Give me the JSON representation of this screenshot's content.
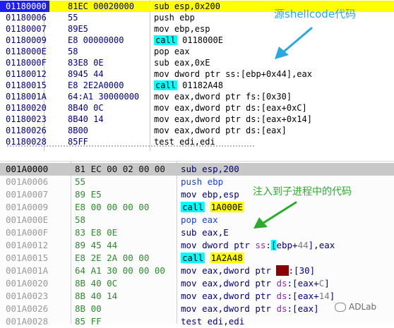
{
  "top_panel": {
    "annotation": "源shellcode代码",
    "rows": [
      {
        "addr": "01180000",
        "hex": "81EC 00020000",
        "pre": "sub esp,0x200",
        "call": "",
        "post": ""
      },
      {
        "addr": "01180006",
        "hex": "55",
        "pre": "push ebp",
        "call": "",
        "post": ""
      },
      {
        "addr": "01180007",
        "hex": "89E5",
        "pre": "mov ebp,esp",
        "call": "",
        "post": ""
      },
      {
        "addr": "01180009",
        "hex": "E8 00000000",
        "pre": "",
        "call": "call",
        "post": " 0118000E"
      },
      {
        "addr": "0118000E",
        "hex": "58",
        "pre": "pop eax",
        "call": "",
        "post": ""
      },
      {
        "addr": "0118000F",
        "hex": "83E8 0E",
        "pre": "sub eax,0xE",
        "call": "",
        "post": ""
      },
      {
        "addr": "01180012",
        "hex": "8945 44",
        "pre": "mov dword ptr ss:[ebp+0x44],eax",
        "call": "",
        "post": ""
      },
      {
        "addr": "01180015",
        "hex": "E8 2E2A0000",
        "pre": "",
        "call": "call",
        "post": " 01182A48"
      },
      {
        "addr": "0118001A",
        "hex": "64:A1 30000000",
        "pre": "mov eax,dword ptr fs:[0x30]",
        "call": "",
        "post": ""
      },
      {
        "addr": "01180020",
        "hex": "8B40 0C",
        "pre": "mov eax,dword ptr ds:[eax+0xC]",
        "call": "",
        "post": ""
      },
      {
        "addr": "01180023",
        "hex": "8B40 14",
        "pre": "mov eax,dword ptr ds:[eax+0x14]",
        "call": "",
        "post": ""
      },
      {
        "addr": "01180026",
        "hex": "8B00",
        "pre": "mov eax,dword ptr ds:[eax]",
        "call": "",
        "post": ""
      },
      {
        "addr": "01180028",
        "hex": "85FF",
        "pre": "test edi,edi",
        "call": "",
        "post": ""
      }
    ]
  },
  "bottom_panel": {
    "annotation": "注入到子进程中的代码",
    "rows": [
      {
        "addr": "001A0000",
        "hex": "81 EC 00 02 00 00",
        "dis": "sub esp,200"
      },
      {
        "addr": "001A0006",
        "hex": "55",
        "dis": "push ebp"
      },
      {
        "addr": "001A0007",
        "hex": "89 E5",
        "dis": "mov ebp,esp"
      },
      {
        "addr": "001A0009",
        "hex": "E8 00 00 00 00",
        "dis": "call 1A000E"
      },
      {
        "addr": "001A000E",
        "hex": "58",
        "dis": "pop eax"
      },
      {
        "addr": "001A000F",
        "hex": "83 E8 0E",
        "dis": "sub eax,E"
      },
      {
        "addr": "001A0012",
        "hex": "89 45 44",
        "dis": "mov dword ptr ss:[ebp+44],eax"
      },
      {
        "addr": "001A0015",
        "hex": "E8 2E 2A 00 00",
        "dis": "call 1A2A48"
      },
      {
        "addr": "001A001A",
        "hex": "64 A1 30 00 00 00",
        "dis": "mov eax,dword ptr fs:[30]"
      },
      {
        "addr": "001A0020",
        "hex": "8B 40 0C",
        "dis": "mov eax,dword ptr ds:[eax+C]"
      },
      {
        "addr": "001A0023",
        "hex": "8B 40 14",
        "dis": "mov eax,dword ptr ds:[eax+14]"
      },
      {
        "addr": "001A0026",
        "hex": "8B 00",
        "dis": "mov eax,dword ptr ds:[eax]"
      },
      {
        "addr": "001A0028",
        "hex": "85 FF",
        "dis": "test edi,edi"
      }
    ]
  },
  "watermark": "ADLab",
  "colors": {
    "top_selection": "#ffff00",
    "top_address_selected": "#1e1ef0",
    "call_highlight": "#00ffff",
    "bottom_selection": "#c8c8c8",
    "annotation_top": "#29a8e0",
    "annotation_bottom": "#2eaa2e"
  }
}
